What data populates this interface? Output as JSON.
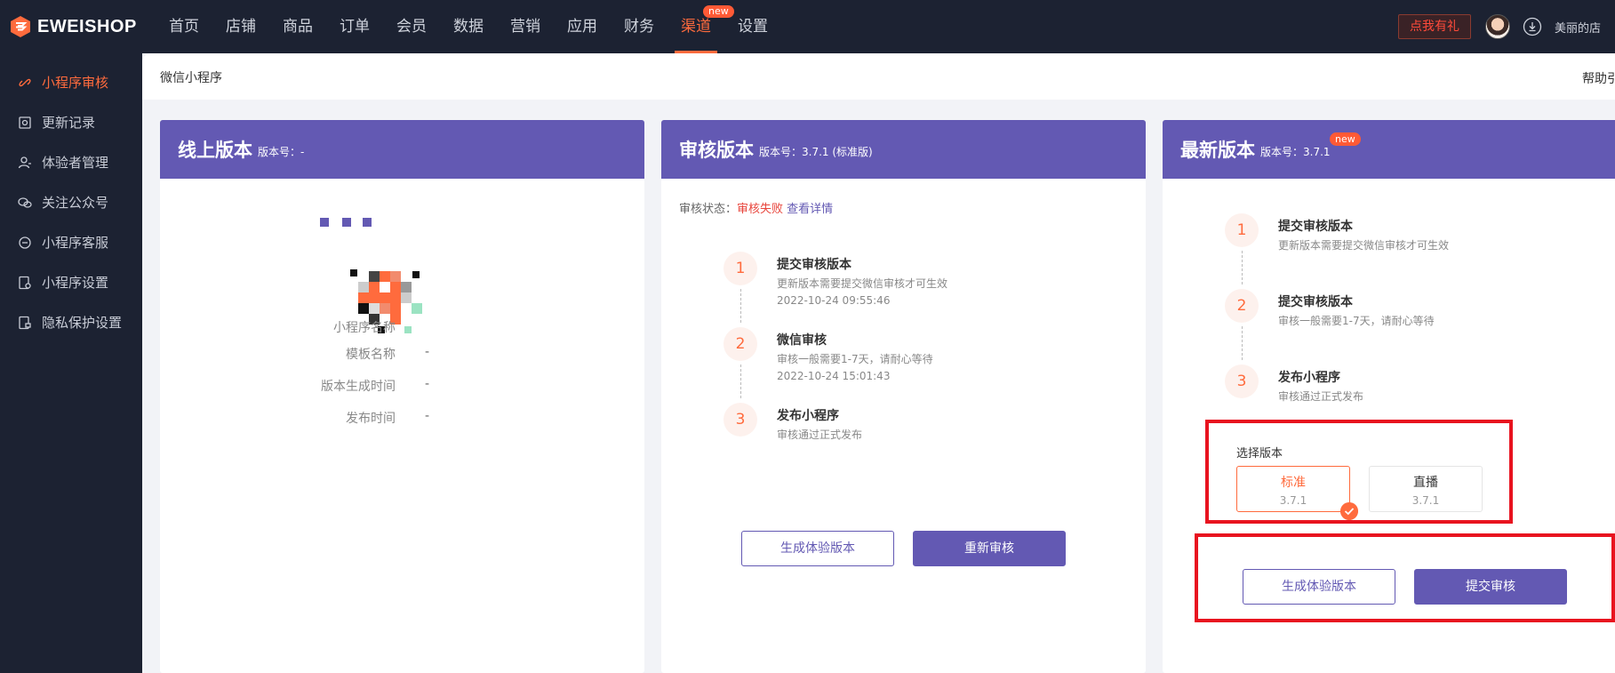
{
  "brand": {
    "name": "EWEISHOP",
    "accent": "#ff6b3d",
    "nav_bg": "#1c2232",
    "card_head": "#6359b3",
    "highlight": "#e8131f"
  },
  "nav": [
    {
      "label": "首页"
    },
    {
      "label": "店铺"
    },
    {
      "label": "商品"
    },
    {
      "label": "订单"
    },
    {
      "label": "会员"
    },
    {
      "label": "数据"
    },
    {
      "label": "营销"
    },
    {
      "label": "应用"
    },
    {
      "label": "财务"
    },
    {
      "label": "渠道",
      "badge": "new",
      "active": true
    },
    {
      "label": "设置"
    }
  ],
  "topbar": {
    "gift": "点我有礼",
    "shop_name": "美丽的店"
  },
  "sidebar": [
    {
      "label": "小程序审核",
      "icon": "link-icon",
      "active": true
    },
    {
      "label": "更新记录",
      "icon": "record-icon"
    },
    {
      "label": "体验者管理",
      "icon": "user-icon"
    },
    {
      "label": "关注公众号",
      "icon": "wechat-icon"
    },
    {
      "label": "小程序客服",
      "icon": "chat-icon"
    },
    {
      "label": "小程序设置",
      "icon": "settings-doc-icon"
    },
    {
      "label": "隐私保护设置",
      "icon": "privacy-doc-icon"
    }
  ],
  "page": {
    "title": "微信小程序",
    "help": "帮助引"
  },
  "online": {
    "title": "线上版本",
    "version": "版本号：-",
    "info": [
      {
        "label": "小程序名称",
        "value": ""
      },
      {
        "label": "模板名称",
        "value": "-"
      },
      {
        "label": "版本生成时间",
        "value": "-"
      },
      {
        "label": "发布时间",
        "value": "-"
      }
    ]
  },
  "review": {
    "title": "审核版本",
    "version": "版本号：3.7.1 (标准版)",
    "status_label": "审核状态：",
    "status_value": "审核失败",
    "status_link": "查看详情",
    "steps": [
      {
        "num": "1",
        "title": "提交审核版本",
        "desc": "更新版本需要提交微信审核才可生效",
        "time": "2022-10-24 09:55:46"
      },
      {
        "num": "2",
        "title": "微信审核",
        "desc": "审核一般需要1-7天，请耐心等待",
        "time": "2022-10-24 15:01:43"
      },
      {
        "num": "3",
        "title": "发布小程序",
        "desc": "审核通过正式发布",
        "time": ""
      }
    ],
    "btn_trial": "生成体验版本",
    "btn_resubmit": "重新审核"
  },
  "latest": {
    "title": "最新版本",
    "version": "版本号：3.7.1",
    "badge": "new",
    "steps": [
      {
        "num": "1",
        "title": "提交审核版本",
        "desc": "更新版本需要提交微信审核才可生效"
      },
      {
        "num": "2",
        "title": "提交审核版本",
        "desc": "审核一般需要1-7天，请耐心等待"
      },
      {
        "num": "3",
        "title": "发布小程序",
        "desc": "审核通过正式发布"
      }
    ],
    "select_label": "选择版本",
    "options": [
      {
        "name": "标准",
        "version": "3.7.1",
        "selected": true
      },
      {
        "name": "直播",
        "version": "3.7.1",
        "selected": false
      }
    ],
    "btn_trial": "生成体验版本",
    "btn_submit": "提交审核"
  }
}
